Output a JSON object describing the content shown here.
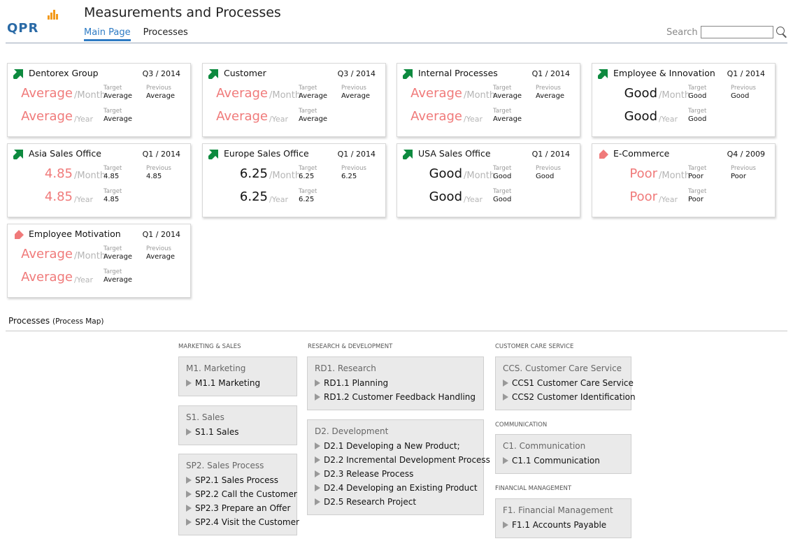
{
  "app": {
    "title": "Measurements and Processes",
    "logo_text": "QPR",
    "tabs": [
      "Main Page",
      "Processes"
    ],
    "active_tab": "Main Page",
    "search_label": "Search",
    "search_value": ""
  },
  "colors": {
    "accent": "#2e7bc4",
    "good": "#0d8a3f",
    "poor": "#f07a7a",
    "logo_bars": "#f39a1c"
  },
  "cards": [
    {
      "name": "Dentorex Group",
      "period": "Q3 / 2014",
      "trend": "up-green",
      "month": "Average",
      "year": "Average",
      "color": "red",
      "target_label": "Target",
      "previous_label": "Previous",
      "month_target": "Average",
      "month_previous": "Average",
      "year_target": "Average",
      "unit_month": "/Month",
      "unit_year": "/Year"
    },
    {
      "name": "Customer",
      "period": "Q3 / 2014",
      "trend": "up-green",
      "month": "Average",
      "year": "Average",
      "color": "red",
      "target_label": "Target",
      "previous_label": "Previous",
      "month_target": "Average",
      "month_previous": "Average",
      "year_target": "Average",
      "unit_month": "/Month",
      "unit_year": "/Year"
    },
    {
      "name": "Internal Processes",
      "period": "Q1 / 2014",
      "trend": "up-green",
      "month": "Average",
      "year": "Average",
      "color": "red",
      "target_label": "Target",
      "previous_label": "Previous",
      "month_target": "Average",
      "month_previous": "Average",
      "year_target": "Average",
      "unit_month": "/Month",
      "unit_year": "/Year"
    },
    {
      "name": "Employee & Innovation",
      "period": "Q1 / 2014",
      "trend": "up-green",
      "month": "Good",
      "year": "Good",
      "color": "black",
      "target_label": "Target",
      "previous_label": "Previous",
      "month_target": "Good",
      "month_previous": "Good",
      "year_target": "Good",
      "unit_month": "/Month",
      "unit_year": "/Year"
    },
    {
      "name": "Asia Sales Office",
      "period": "Q1 / 2014",
      "trend": "up-green",
      "month": "4.85",
      "year": "4.85",
      "color": "red",
      "target_label": "Target",
      "previous_label": "Previous",
      "month_target": "4.85",
      "month_previous": "4.85",
      "year_target": "4.85",
      "unit_month": "/Month",
      "unit_year": "/Year"
    },
    {
      "name": "Europe Sales Office",
      "period": "Q1 / 2014",
      "trend": "up-green",
      "month": "6.25",
      "year": "6.25",
      "color": "black",
      "target_label": "Target",
      "previous_label": "Previous",
      "month_target": "6.25",
      "month_previous": "6.25",
      "year_target": "6.25",
      "unit_month": "/Month",
      "unit_year": "/Year"
    },
    {
      "name": "USA Sales Office",
      "period": "Q1 / 2014",
      "trend": "up-green",
      "month": "Good",
      "year": "Good",
      "color": "black",
      "target_label": "Target",
      "previous_label": "Previous",
      "month_target": "Good",
      "month_previous": "Good",
      "year_target": "Good",
      "unit_month": "/Month",
      "unit_year": "/Year"
    },
    {
      "name": "E-Commerce",
      "period": "Q4 / 2009",
      "trend": "down-red",
      "month": "Poor",
      "year": "Poor",
      "color": "red",
      "target_label": "Target",
      "previous_label": "Previous",
      "month_target": "Poor",
      "month_previous": "Poor",
      "year_target": "Poor",
      "unit_month": "/Month",
      "unit_year": "/Year"
    },
    {
      "name": "Employee Motivation",
      "period": "Q1 / 2014",
      "trend": "down-red",
      "month": "Average",
      "year": "Average",
      "color": "red",
      "target_label": "Target",
      "previous_label": "Previous",
      "month_target": "Average",
      "month_previous": "Average",
      "year_target": "Average",
      "unit_month": "/Month",
      "unit_year": "/Year"
    }
  ],
  "processes": {
    "heading": "Processes",
    "subheading": "(Process Map)",
    "categories": [
      "MARKETING & SALES",
      "RESEARCH & DEVELOPMENT",
      "CUSTOMER CARE SERVICE",
      "COMMUNICATION",
      "FINANCIAL MANAGEMENT"
    ],
    "boxes": [
      {
        "title": "M1. Marketing",
        "items": [
          "M1.1 Marketing"
        ]
      },
      {
        "title": "S1. Sales",
        "items": [
          "S1.1 Sales"
        ]
      },
      {
        "title": "SP2. Sales Process",
        "items": [
          "SP2.1 Sales Process",
          "SP2.2 Call the Customer",
          "SP2.3 Prepare an Offer",
          "SP2.4 Visit the Customer"
        ]
      },
      {
        "title": "RD1. Research",
        "items": [
          "RD1.1 Planning",
          "RD1.2 Customer Feedback Handling"
        ]
      },
      {
        "title": "D2. Development",
        "items": [
          "D2.1 Developing a New Product;",
          "D2.2 Incremental Development Process",
          "D2.3 Release Process",
          "D2.4 Developing an Existing Product",
          "D2.5 Research Project"
        ]
      },
      {
        "title": "CCS. Customer Care Service",
        "items": [
          "CCS1 Customer Care Service",
          "CCS2 Customer Identification"
        ]
      },
      {
        "title": "C1. Communication",
        "items": [
          "C1.1 Communication"
        ]
      },
      {
        "title": "F1. Financial Management",
        "items": [
          "F1.1 Accounts Payable"
        ]
      }
    ]
  }
}
